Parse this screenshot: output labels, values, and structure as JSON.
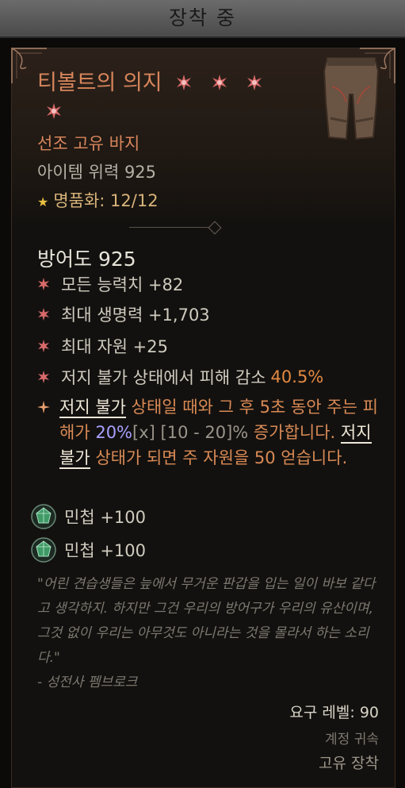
{
  "header": {
    "title": "장착 중"
  },
  "item": {
    "name": "티볼트의 의지",
    "type": "선조 고유 바지",
    "item_power": "아이템 위력 925",
    "masterwork_label": "명품화: 12/12",
    "armor": "방어도 925"
  },
  "affixes": [
    {
      "text": "모든 능력치 +82",
      "highlight": ""
    },
    {
      "text": "최대 생명력 +1,703",
      "highlight": ""
    },
    {
      "text": "최대 자원 +25",
      "highlight": ""
    },
    {
      "text": "저지 불가 상태에서 피해 감소",
      "highlight": "40.5%"
    }
  ],
  "unique_power": {
    "kw1": "저지 불가",
    "part1": " 상태일 때와 그 후 5초 동안 주는 피해가 ",
    "value": "20%",
    "range_marker": "[x]",
    "range": " [10 - 20]%",
    "part2": " 증가합니다. ",
    "kw2": "저지 불가",
    "part3": " 상태가 되면 주 자원을 50 얻습니다."
  },
  "gems": [
    {
      "text": "민첩 +100"
    },
    {
      "text": "민첩 +100"
    }
  ],
  "flavor": {
    "text": "\"어린 견습생들은 늪에서 무거운 판갑을 입는 일이 바보 같다고 생각하지. 하지만 그건 우리의 방어구가 우리의 유산이며, 그것 없이 우리는 아무것도 아니라는 것을 몰라서 하는 소리다.\"",
    "author": "- 성전사 펨브로크"
  },
  "footer": {
    "required_level": "요구 레벨: 90",
    "account_bound": "계정 귀속",
    "unique_equipped": "고유 장착"
  },
  "colors": {
    "unique_orange": "#d7855b",
    "affix_highlight": "#e28a43",
    "value_purple": "#a7a0ff"
  }
}
